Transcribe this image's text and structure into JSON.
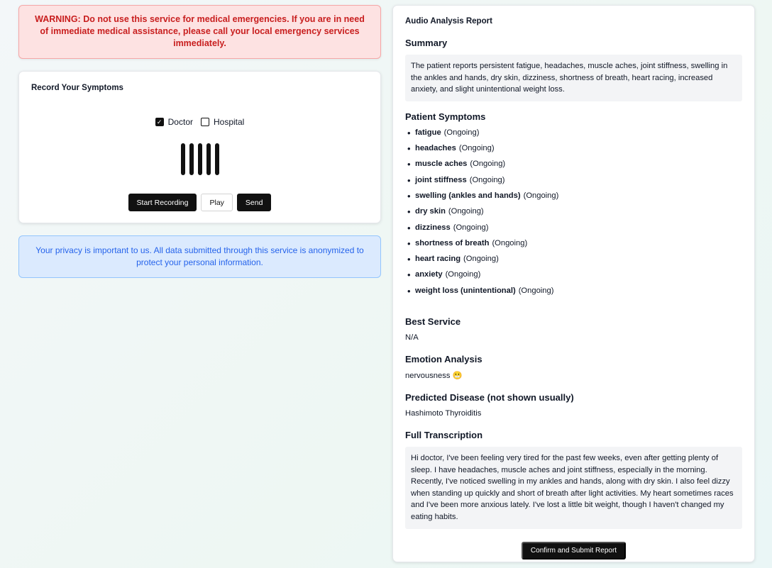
{
  "warning": "WARNING: Do not use this service for medical emergencies. If you are in need of immediate medical assistance, please call your local emergency services immediately.",
  "recorder": {
    "title": "Record Your Symptoms",
    "options": [
      {
        "label": "Doctor",
        "checked": true
      },
      {
        "label": "Hospital",
        "checked": false
      }
    ],
    "buttons": {
      "start": "Start Recording",
      "play": "Play",
      "send": "Send"
    }
  },
  "privacy": "Your privacy is important to us. All data submitted through this service is anonymized to protect your personal information.",
  "report": {
    "title": "Audio Analysis Report",
    "summary_heading": "Summary",
    "summary": "The patient reports persistent fatigue, headaches, muscle aches, joint stiffness, swelling in the ankles and hands, dry skin, dizziness, shortness of breath, heart racing, increased anxiety, and slight unintentional weight loss.",
    "symptoms_heading": "Patient Symptoms",
    "symptoms": [
      {
        "name": "fatigue",
        "status": "(Ongoing)"
      },
      {
        "name": "headaches",
        "status": "(Ongoing)"
      },
      {
        "name": "muscle aches",
        "status": "(Ongoing)"
      },
      {
        "name": "joint stiffness",
        "status": "(Ongoing)"
      },
      {
        "name": "swelling (ankles and hands)",
        "status": "(Ongoing)"
      },
      {
        "name": "dry skin",
        "status": "(Ongoing)"
      },
      {
        "name": "dizziness",
        "status": "(Ongoing)"
      },
      {
        "name": "shortness of breath",
        "status": "(Ongoing)"
      },
      {
        "name": "heart racing",
        "status": "(Ongoing)"
      },
      {
        "name": "anxiety",
        "status": "(Ongoing)"
      },
      {
        "name": "weight loss (unintentional)",
        "status": "(Ongoing)"
      }
    ],
    "service_heading": "Best Service",
    "service": "N/A",
    "emotion_heading": "Emotion Analysis",
    "emotion": "nervousness 😬",
    "disease_heading": "Predicted Disease (not shown usually)",
    "disease": "Hashimoto Thyroiditis",
    "transcription_heading": "Full Transcription",
    "transcription": "Hi doctor, I've been feeling very tired for the past few weeks, even after getting plenty of sleep. I have headaches, muscle aches and joint stiffness, especially in the morning. Recently, I've noticed swelling in my ankles and hands, along with dry skin. I also feel dizzy when standing up quickly and short of breath after light activities. My heart sometimes races and I've been more anxious lately. I've lost a little bit weight, though I haven't changed my eating habits.",
    "submit": "Confirm and Submit Report"
  }
}
